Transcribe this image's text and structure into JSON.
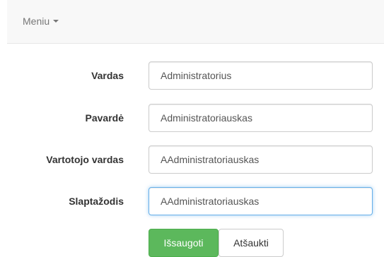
{
  "navbar": {
    "menu_label": "Meniu"
  },
  "form": {
    "fields": [
      {
        "label": "Vardas",
        "value": "Administratorius"
      },
      {
        "label": "Pavardė",
        "value": "Administratoriauskas"
      },
      {
        "label": "Vartotojo vardas",
        "value": "AAdministratoriauskas"
      },
      {
        "label": "Slaptažodis",
        "value": "AAdministratoriauskas"
      }
    ],
    "save_label": "Išsaugoti",
    "cancel_label": "Atšaukti"
  },
  "colors": {
    "save_button": "#5cb85c",
    "focus_border": "#66afe9",
    "navbar_bg": "#f8f8f8"
  },
  "icons": {
    "menu_dropdown": "caret-down-icon"
  }
}
